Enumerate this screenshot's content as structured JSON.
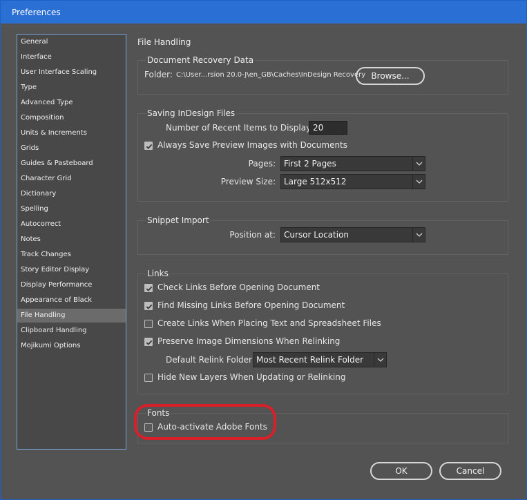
{
  "window": {
    "title": "Preferences"
  },
  "sidebar": {
    "items": [
      {
        "label": "General"
      },
      {
        "label": "Interface"
      },
      {
        "label": "User Interface Scaling"
      },
      {
        "label": "Type"
      },
      {
        "label": "Advanced Type"
      },
      {
        "label": "Composition"
      },
      {
        "label": "Units & Increments"
      },
      {
        "label": "Grids"
      },
      {
        "label": "Guides & Pasteboard"
      },
      {
        "label": "Character Grid"
      },
      {
        "label": "Dictionary"
      },
      {
        "label": "Spelling"
      },
      {
        "label": "Autocorrect"
      },
      {
        "label": "Notes"
      },
      {
        "label": "Track Changes"
      },
      {
        "label": "Story Editor Display"
      },
      {
        "label": "Display Performance"
      },
      {
        "label": "Appearance of Black"
      },
      {
        "label": "File Handling"
      },
      {
        "label": "Clipboard Handling"
      },
      {
        "label": "Mojikumi Options"
      }
    ],
    "selected": "File Handling"
  },
  "panel": {
    "heading": "File Handling",
    "recovery": {
      "title": "Document Recovery Data",
      "folder_label": "Folder:",
      "folder_path": "C:\\User...rsion 20.0-J\\en_GB\\Caches\\InDesign Recovery",
      "browse_label": "Browse..."
    },
    "saving": {
      "title": "Saving InDesign Files",
      "recent_label": "Number of Recent Items to Display:",
      "recent_value": "20",
      "preview_label": "Always Save Preview Images with Documents",
      "preview_checked": true,
      "pages_label": "Pages:",
      "pages_value": "First 2 Pages",
      "size_label": "Preview Size:",
      "size_value": "Large 512x512"
    },
    "snippet": {
      "title": "Snippet Import",
      "position_label": "Position at:",
      "position_value": "Cursor Location"
    },
    "links": {
      "title": "Links",
      "items": [
        {
          "label": "Check Links Before Opening Document",
          "checked": true
        },
        {
          "label": "Find Missing Links Before Opening Document",
          "checked": true
        },
        {
          "label": "Create Links When Placing Text and Spreadsheet Files",
          "checked": false
        },
        {
          "label": "Preserve Image Dimensions When Relinking",
          "checked": true
        }
      ],
      "relink_label": "Default Relink Folder:",
      "relink_value": "Most Recent Relink Folder",
      "hide_label": "Hide New Layers When Updating or Relinking",
      "hide_checked": false
    },
    "fonts": {
      "title": "Fonts",
      "auto_label": "Auto-activate Adobe Fonts",
      "auto_checked": false
    }
  },
  "buttons": {
    "ok": "OK",
    "cancel": "Cancel"
  },
  "colors": {
    "titlebar": "#2a6fd4",
    "highlight": "#d81f2a",
    "background": "#535353"
  }
}
